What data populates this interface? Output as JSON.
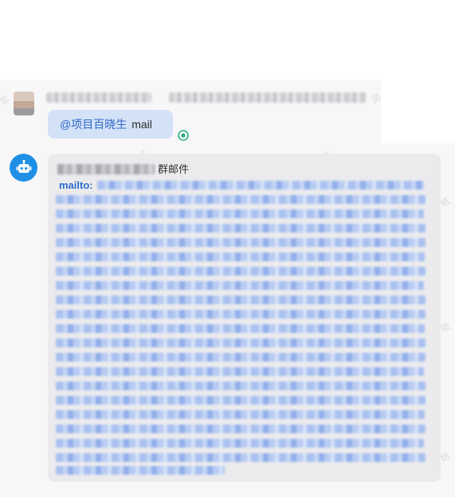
{
  "messages": [
    {
      "mention": "@项目百晓生",
      "text": "mail",
      "status_icon": "read-receipt-icon"
    },
    {
      "avatar_icon": "robot-icon",
      "group_label": "群邮件",
      "link_prefix": "mailto:"
    }
  ],
  "colors": {
    "chat_bg": "#f7f7f8",
    "sent_bubble": "#d4e2f7",
    "received_bubble": "#ebebed",
    "mention": "#2e68c8",
    "link": "#2f6ccc",
    "bot_avatar": "#1f8fe6",
    "read_receipt": "#2bb37c"
  }
}
